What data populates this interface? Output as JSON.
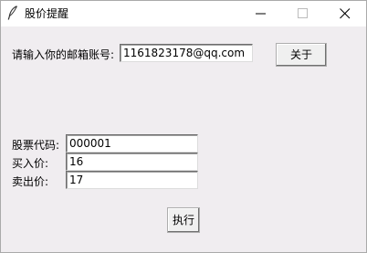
{
  "window": {
    "title": "股价提醒",
    "icons": {
      "app": "feather-icon",
      "minimize": "minimize-icon",
      "maximize": "maximize-icon",
      "close": "close-icon"
    }
  },
  "email": {
    "label": "请输入你的邮箱账号:",
    "value": "1161823178@qq.com"
  },
  "about_button": {
    "label": "关于"
  },
  "stock": {
    "code_label": "股票代码:",
    "code_value": "000001",
    "buy_label": "买入价:",
    "buy_value": "16",
    "sell_label": "卖出价:",
    "sell_value": "17"
  },
  "execute_button": {
    "label": "执行"
  }
}
